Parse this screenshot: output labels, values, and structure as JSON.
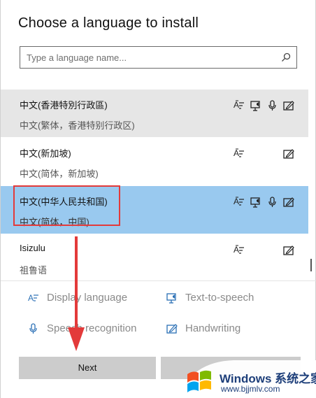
{
  "dialog": {
    "title": "Choose a language to install",
    "search": {
      "placeholder": "Type a language name..."
    }
  },
  "languages": [
    {
      "name": "中文(香港特別行政區)",
      "sub": "中文(繁体，香港特别行政区)",
      "state": "hover"
    },
    {
      "name": "中文(新加坡)",
      "sub": "中文(简体，新加坡)",
      "state": "normal"
    },
    {
      "name": "中文(中华人民共和国)",
      "sub": "中文(简体，中国)",
      "state": "selected"
    },
    {
      "name": "Isizulu",
      "sub": "祖鲁语",
      "state": "normal"
    }
  ],
  "legend": {
    "display_language": "Display language",
    "text_to_speech": "Text-to-speech",
    "speech_recognition": "Speech recognition",
    "handwriting": "Handwriting"
  },
  "buttons": {
    "next": "Next",
    "cancel": ""
  },
  "watermark": {
    "title": "Windows 系统之家",
    "url": "www.bjjmlv.com"
  },
  "colors": {
    "selected": "#99c9ef",
    "hover": "#e6e6e6",
    "annotation": "#e33a3a",
    "button": "#cccccc"
  }
}
